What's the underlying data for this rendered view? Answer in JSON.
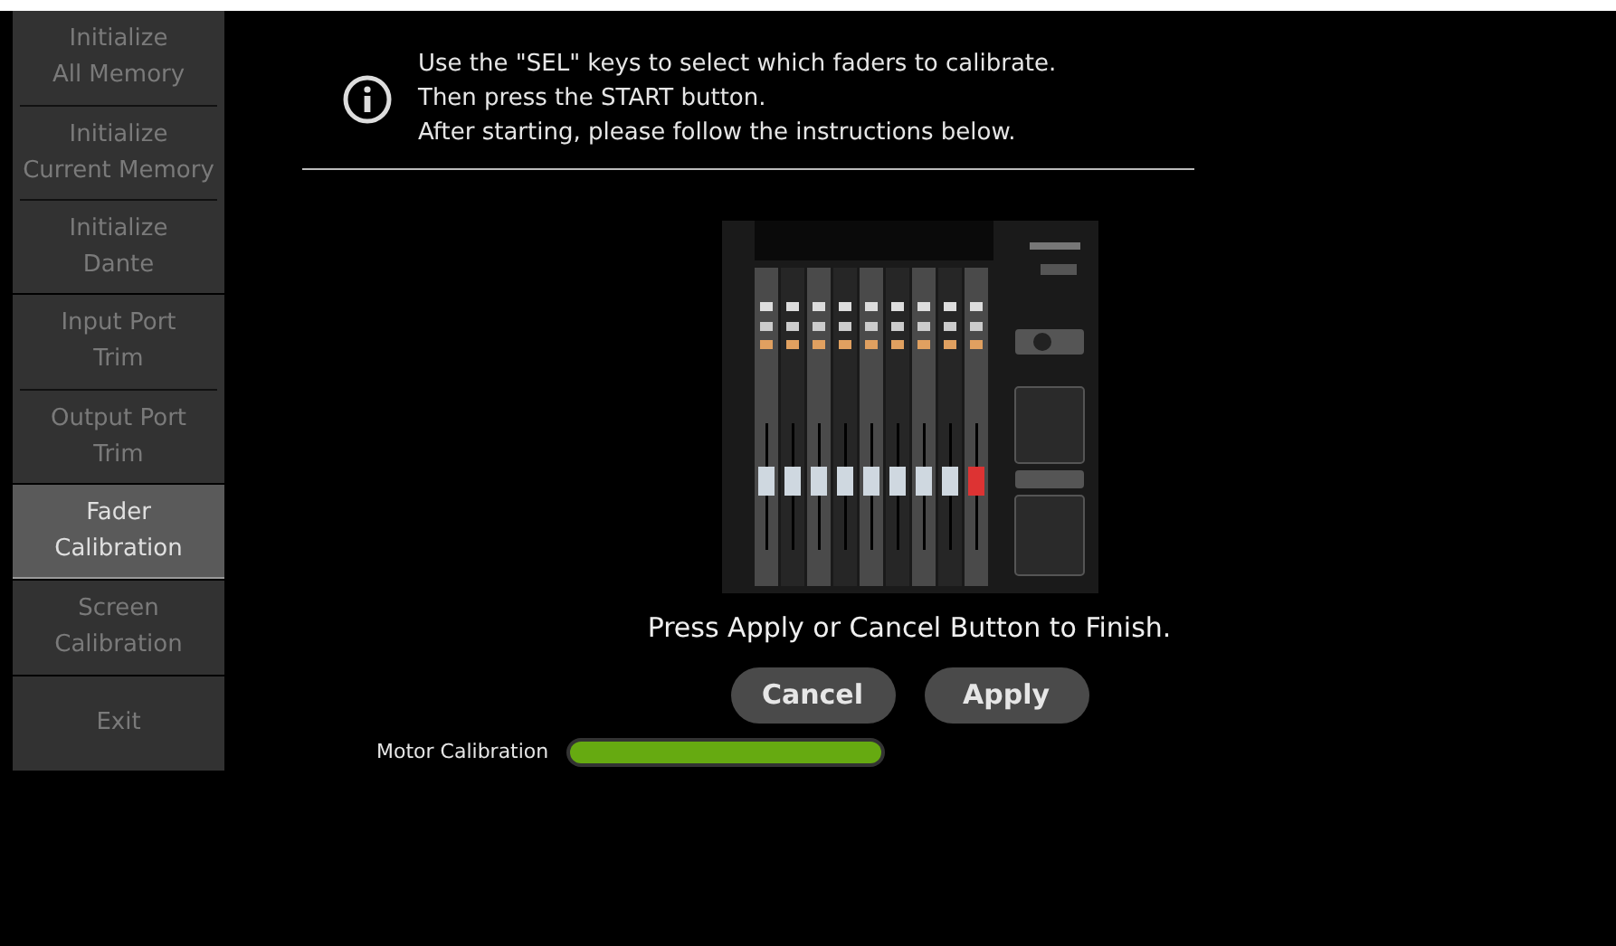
{
  "sidebar": {
    "groups": [
      {
        "items": [
          {
            "label": "Initialize\nAll Memory",
            "disabled": true,
            "selected": false
          },
          {
            "label": "Initialize\nCurrent Memory",
            "disabled": true,
            "selected": false
          },
          {
            "label": "Initialize\nDante",
            "disabled": true,
            "selected": false
          }
        ]
      },
      {
        "items": [
          {
            "label": "Input Port\nTrim",
            "disabled": true,
            "selected": false
          },
          {
            "label": "Output Port\nTrim",
            "disabled": true,
            "selected": false
          }
        ]
      },
      {
        "items": [
          {
            "label": "Fader\nCalibration",
            "disabled": false,
            "selected": true
          }
        ]
      },
      {
        "items": [
          {
            "label": "Screen\nCalibration",
            "disabled": true,
            "selected": false
          }
        ]
      },
      {
        "items": [
          {
            "label": "Exit",
            "disabled": true,
            "selected": false
          }
        ]
      }
    ]
  },
  "instructions": [
    "Use the \"SEL\" keys to select which faders to calibrate.",
    "Then press the START button.",
    "After starting, please follow the instructions below."
  ],
  "finish_message": "Press Apply or Cancel Button to Finish.",
  "buttons": [
    "Cancel",
    "Apply"
  ],
  "progress": {
    "label": "Motor Calibration",
    "level": 1
  }
}
